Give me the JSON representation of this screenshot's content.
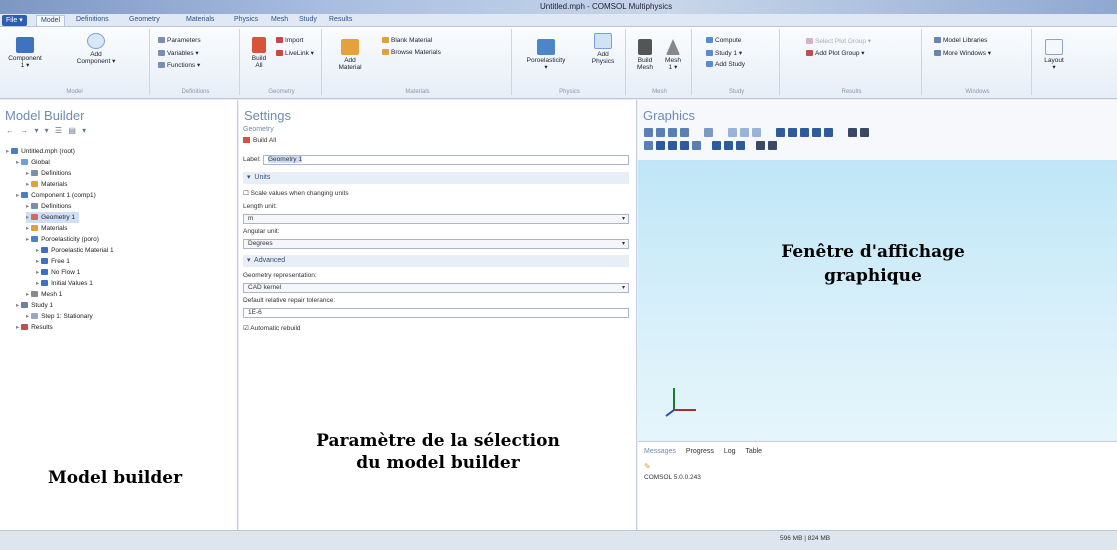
{
  "window": {
    "title": "Untitled.mph - COMSOL Multiphysics"
  },
  "ribbon_tabs": [
    "File ▾",
    "Model",
    "Definitions",
    "Geometry",
    "Materials",
    "Physics",
    "Mesh",
    "Study",
    "Results"
  ],
  "ribbon": {
    "model": {
      "component": "Component\n1 ▾",
      "add_component": "Add\nComponent ▾",
      "label": "Model"
    },
    "definitions": {
      "parameters": "Parameters",
      "variables": "Variables ▾",
      "functions": "Functions ▾",
      "label": "Definitions"
    },
    "geometry": {
      "build_all": "Build\nAll",
      "import": "Import",
      "livelink": "LiveLink ▾",
      "label": "Geometry"
    },
    "materials": {
      "add_material": "Add\nMaterial",
      "blank_material": "Blank Material",
      "browse_materials": "Browse Materials",
      "label": "Materials"
    },
    "physics": {
      "poroelasticity": "Poroelasticity\n▾",
      "add_physics": "Add\nPhysics",
      "label": "Physics"
    },
    "mesh": {
      "build_mesh": "Build\nMesh",
      "mesh": "Mesh\n1 ▾",
      "label": "Mesh"
    },
    "study": {
      "compute": "Compute",
      "study1": "Study 1 ▾",
      "add_study": "Add Study",
      "label": "Study"
    },
    "results": {
      "select_plot_group": "Select Plot Group ▾",
      "add_plot_group": "Add Plot Group ▾",
      "label": "Results"
    },
    "windows": {
      "model_libraries": "Model Libraries",
      "more_windows": "More Windows ▾",
      "label": "Windows"
    },
    "layout": {
      "label": "Layout\n▾"
    }
  },
  "model_builder": {
    "title": "Model Builder",
    "tree": [
      {
        "label": "Untitled.mph (root)",
        "indent": 0,
        "color": "#4a7ec2"
      },
      {
        "label": "Global",
        "indent": 1,
        "color": "#6ba0d8"
      },
      {
        "label": "Definitions",
        "indent": 2,
        "color": "#7a8fb0"
      },
      {
        "label": "Materials",
        "indent": 2,
        "color": "#e0a040"
      },
      {
        "label": "Component 1 (comp1)",
        "indent": 1,
        "color": "#4a7ec2"
      },
      {
        "label": "Definitions",
        "indent": 2,
        "color": "#7a8fb0"
      },
      {
        "label": "Geometry 1",
        "indent": 2,
        "color": "#d06a5a",
        "selected": true
      },
      {
        "label": "Materials",
        "indent": 2,
        "color": "#e0a040"
      },
      {
        "label": "Poroelasticity (poro)",
        "indent": 2,
        "color": "#4f7fc7"
      },
      {
        "label": "Poroelastic Material 1",
        "indent": 3,
        "color": "#3f6fbf"
      },
      {
        "label": "Free 1",
        "indent": 3,
        "color": "#3f6fbf"
      },
      {
        "label": "No Flow 1",
        "indent": 3,
        "color": "#3f6fbf"
      },
      {
        "label": "Initial Values 1",
        "indent": 3,
        "color": "#3f6fbf"
      },
      {
        "label": "Mesh 1",
        "indent": 2,
        "color": "#8a8a8a"
      },
      {
        "label": "Study 1",
        "indent": 1,
        "color": "#6c7fa5"
      },
      {
        "label": "Step 1: Stationary",
        "indent": 2,
        "color": "#9aa8bf"
      },
      {
        "label": "Results",
        "indent": 1,
        "color": "#c05050"
      }
    ]
  },
  "settings": {
    "title": "Settings",
    "subtitle": "Geometry",
    "build_all": "Build All",
    "label_caption": "Label:",
    "label_value": "Geometry 1",
    "units_section": "Units",
    "scale_values": "Scale values when changing units",
    "length_unit_caption": "Length unit:",
    "length_unit": "m",
    "angular_unit_caption": "Angular unit:",
    "angular_unit": "Degrees",
    "advanced_section": "Advanced",
    "geom_repr_caption": "Geometry representation:",
    "geom_repr": "CAD kernel",
    "repair_caption": "Default relative repair tolerance:",
    "repair_value": "1E-6",
    "auto_rebuild": "Automatic rebuild"
  },
  "graphics": {
    "title": "Graphics"
  },
  "messages": {
    "tabs": [
      "Messages",
      "Progress",
      "Log",
      "Table"
    ],
    "content": "COMSOL 5.0.0.243"
  },
  "status": {
    "memory": "596 MB | 824 MB"
  },
  "annotations": {
    "model_builder": "Model builder",
    "settings": "Paramètre de la sélection\ndu model builder",
    "graphics": "Fenêtre d'affichage\ngraphique"
  }
}
